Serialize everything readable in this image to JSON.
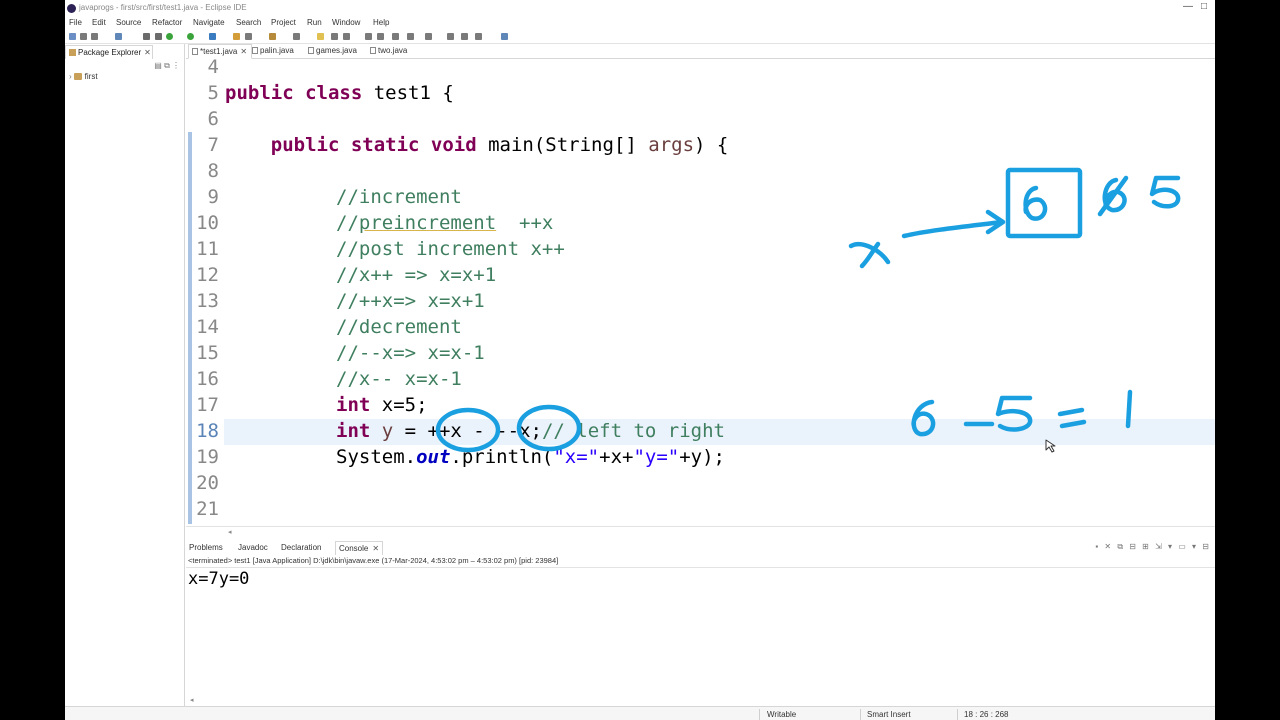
{
  "window": {
    "title": "javaprogs - first/src/first/test1.java - Eclipse IDE",
    "controls": [
      "—",
      "□"
    ]
  },
  "menu": [
    "File",
    "Edit",
    "Source",
    "Refactor",
    "Navigate",
    "Search",
    "Project",
    "Run",
    "Window",
    "Help"
  ],
  "package_explorer": {
    "tab_label": "Package Explorer",
    "project": "first"
  },
  "editor": {
    "tabs": [
      "*test1.java",
      "palin.java",
      "games.java",
      "two.java"
    ],
    "line_numbers": [
      "4",
      "5",
      "6",
      "7",
      "8",
      "9",
      "10",
      "11",
      "12",
      "13",
      "14",
      "15",
      "16",
      "17",
      "18",
      "19",
      "20",
      "21"
    ],
    "lines": {
      "l5a": "public class",
      "l5b": " test1 {",
      "l7a": "    public static void",
      "l7b": " main(String[] ",
      "l7c": "args",
      "l7d": ") {",
      "l9": "//increment",
      "l10a": "//",
      "l10b": "preincrement",
      "l10c": "  ++x",
      "l11": "//post increment x++",
      "l12": "//x++ => x=x+1",
      "l13": "//++x=> x=x+1",
      "l14": "//decrement",
      "l15": "//--x=> x=x-1",
      "l16": "//x-- x=x-1",
      "l17a": "int",
      "l17b": " x=5;",
      "l18a": "int",
      "l18b": " ",
      "l18c": "y",
      "l18d": " = ++x - --x;",
      "l18e": "// left to right",
      "l19a": "System.",
      "l19b": "out",
      "l19c": ".println(",
      "l19d": "\"x=\"",
      "l19e": "+x+",
      "l19f": "\"y=\"",
      "l19g": "+y);"
    }
  },
  "console": {
    "tabs": [
      "Problems",
      "Javadoc",
      "Declaration",
      "Console"
    ],
    "status": "<terminated> test1 [Java Application] D:\\jdk\\bin\\javaw.exe  (17-Mar-2024, 4:53:02 pm – 4:53:02 pm) [pid: 23984]",
    "output": "x=7y=0"
  },
  "statusbar": {
    "mode": "Writable",
    "insert": "Smart Insert",
    "position": "18 : 26 : 268"
  },
  "annotations": {
    "handwriting": [
      "x",
      "6",
      "5",
      "6 - 5 = 1"
    ]
  },
  "colors": {
    "keyword": "#7f0055",
    "comment": "#3f7f5f",
    "string": "#2a00ff",
    "field": "#0000c0",
    "ink": "#1a9fe0",
    "current_line": "#eaf2fb"
  }
}
